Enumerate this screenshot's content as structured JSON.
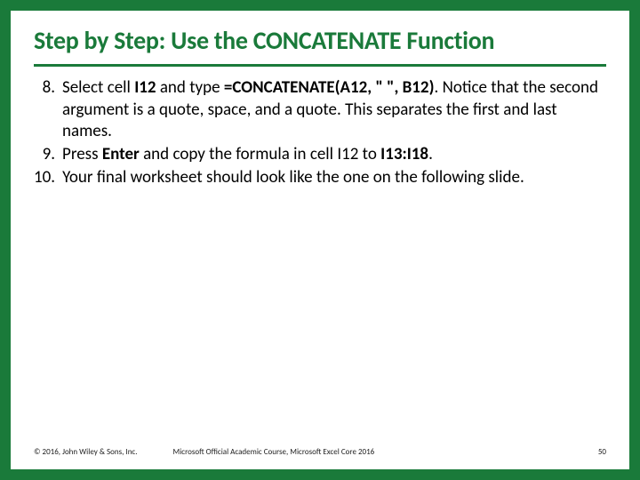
{
  "title": "Step by Step: Use the CONCATENATE Function",
  "steps": [
    {
      "num": "8.",
      "html": "Select cell <b>I12</b> and type <b>=CONCATENATE(A12, \" \", B12)</b>. Notice that the second argument is a quote, space, and a quote. This separates the first and last names."
    },
    {
      "num": "9.",
      "html": "Press <b>Enter</b> and copy the formula in cell I12 to <b>I13:I18</b>."
    },
    {
      "num": "10.",
      "html": "Your final worksheet should look like the one on the following slide."
    }
  ],
  "footer": {
    "copyright": "© 2016, John Wiley & Sons, Inc.",
    "course": "Microsoft Official Academic Course, Microsoft Excel Core 2016",
    "page": "50"
  }
}
